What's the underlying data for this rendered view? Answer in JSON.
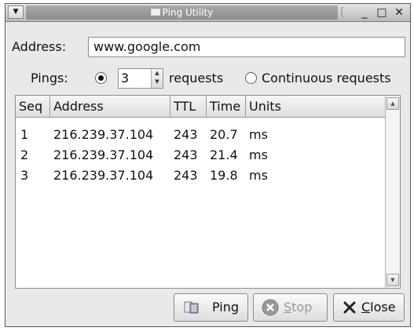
{
  "window": {
    "title": "Ping Utility",
    "menu_symbol": "▼",
    "controls": {
      "separator": "[",
      "minimize": "_",
      "maximize": "□",
      "close": "✕"
    }
  },
  "address": {
    "label": "Address:",
    "value": "www.google.com"
  },
  "pings": {
    "label": "Pings:",
    "count_value": "3",
    "requests_label": "requests",
    "continuous_label": "Continuous requests",
    "selected": "count"
  },
  "table": {
    "columns": [
      "Seq",
      "Address",
      "TTL",
      "Time",
      "Units"
    ],
    "rows": [
      [
        "1",
        "216.239.37.104",
        "243",
        "20.7",
        "ms"
      ],
      [
        "2",
        "216.239.37.104",
        "243",
        "21.4",
        "ms"
      ],
      [
        "3",
        "216.239.37.104",
        "243",
        "19.8",
        "ms"
      ]
    ]
  },
  "buttons": {
    "ping": {
      "label": "Ping",
      "icon": "ping-icon",
      "enabled": true
    },
    "stop": {
      "label_first": "S",
      "label_rest": "top",
      "icon": "stop-icon",
      "enabled": false
    },
    "close": {
      "label_first": "C",
      "label_rest": "lose",
      "icon": "close-x-icon",
      "enabled": true
    }
  }
}
